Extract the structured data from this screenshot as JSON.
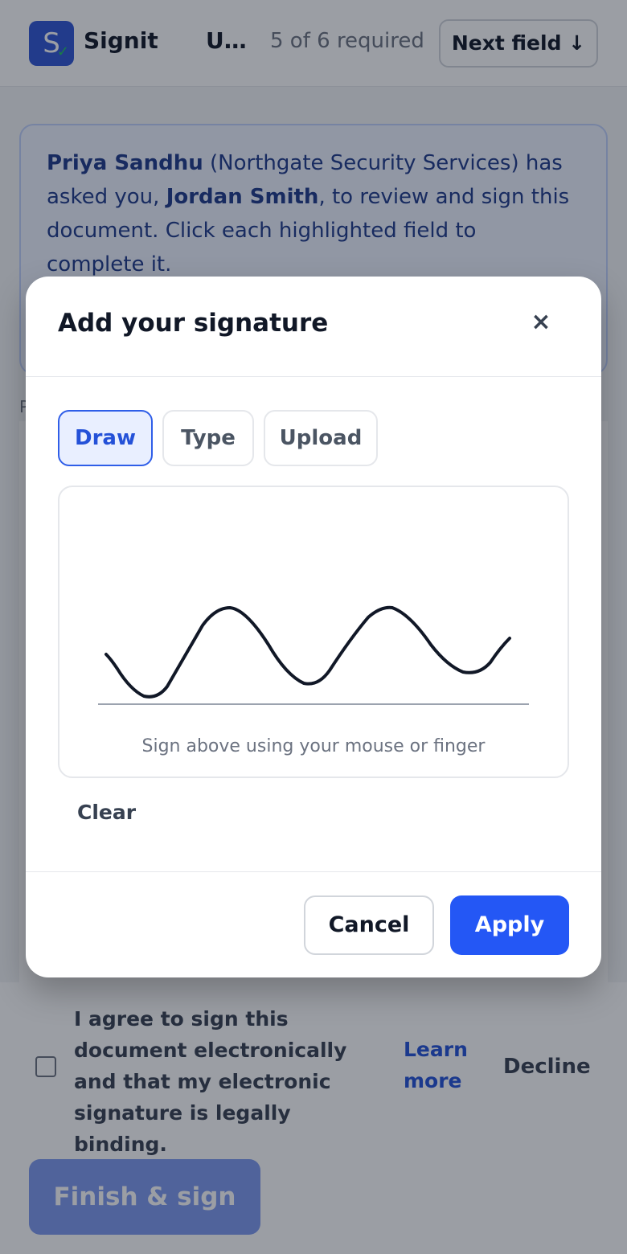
{
  "header": {
    "logo_letter": "S",
    "brand": "Signit",
    "document_title": "U…",
    "progress": "5 of 6 required",
    "next_field_label": "Next field ↓"
  },
  "banner": {
    "sender_name": "Priya Sandhu",
    "sender_org_text": " (Northgate Security Services) has asked you, ",
    "recipient_name": "Jordan Smith",
    "message_tail": ", to review and sign this document. Click each highlighted field to complete it."
  },
  "modal": {
    "title": "Add your signature",
    "close_glyph": "×",
    "tabs": [
      {
        "label": "Draw",
        "active": true
      },
      {
        "label": "Type",
        "active": false
      },
      {
        "label": "Upload",
        "active": false
      }
    ],
    "pad_hint": "Sign above using your mouse or finger",
    "clear_label": "Clear",
    "cancel_label": "Cancel",
    "apply_label": "Apply"
  },
  "consent": {
    "text": "I agree to sign this document electronically and that my electronic signature is legally binding.",
    "checked": false,
    "learn_more": "Learn more",
    "decline": "Decline"
  },
  "footer": {
    "finish_label": "Finish & sign"
  },
  "colors": {
    "accent": "#2457f5",
    "active_tab_bg": "#e9efff",
    "banner_bg": "#eef3ff"
  },
  "icons": {
    "close": "close-icon",
    "next_arrow": "arrow-down-icon",
    "logo_check": "check-icon"
  }
}
